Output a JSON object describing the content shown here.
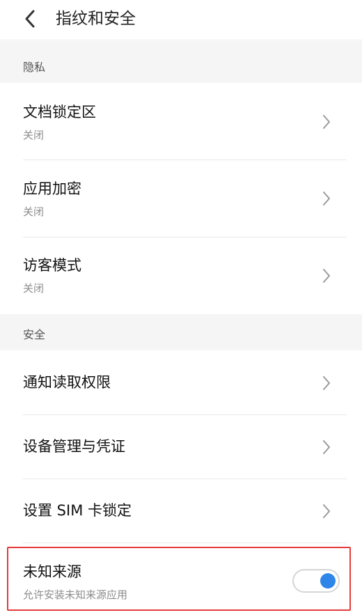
{
  "header": {
    "title": "指纹和安全",
    "back_icon": "chevron-left-icon"
  },
  "sections": [
    {
      "title": "隐私",
      "items": [
        {
          "title": "文档锁定区",
          "subtitle": "关闭"
        },
        {
          "title": "应用加密",
          "subtitle": "关闭"
        },
        {
          "title": "访客模式",
          "subtitle": "关闭"
        }
      ]
    },
    {
      "title": "安全",
      "items": [
        {
          "title": "通知读取权限"
        },
        {
          "title": "设备管理与凭证"
        },
        {
          "title": "设置 SIM 卡锁定"
        },
        {
          "title": "未知来源",
          "subtitle": "允许安装未知来源应用",
          "toggle": true,
          "toggle_on": true
        }
      ]
    }
  ],
  "colors": {
    "toggle_accent": "#2f86e8",
    "highlight_border": "#e63a3a",
    "section_bg": "#f5f5f5"
  }
}
